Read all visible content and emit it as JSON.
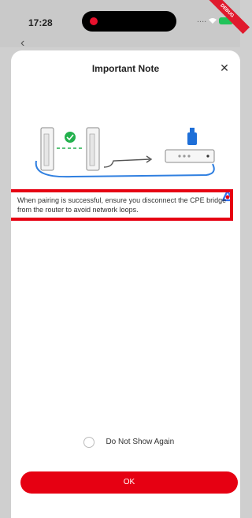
{
  "status": {
    "time": "17:28",
    "signal": "....",
    "ribbon": "DEBUG",
    "battery_color": "#21c35a"
  },
  "dialog": {
    "title": "Important Note",
    "close": "✕",
    "note": "When pairing is successful, ensure you disconnect the CPE bridge from the router to avoid network loops.",
    "dont_show": "Do Not Show Again",
    "ok": "OK"
  },
  "icons": {
    "back": "chevron-left-icon",
    "close": "close-icon",
    "check": "check-circle-icon",
    "scan": "ai-assistant-icon",
    "cpe": "cpe-bridge-icon",
    "router": "router-icon"
  },
  "colors": {
    "accent": "#e60012",
    "success": "#23b14d",
    "cable": "#2f7fe0",
    "router_port": "#1e6fd8"
  }
}
